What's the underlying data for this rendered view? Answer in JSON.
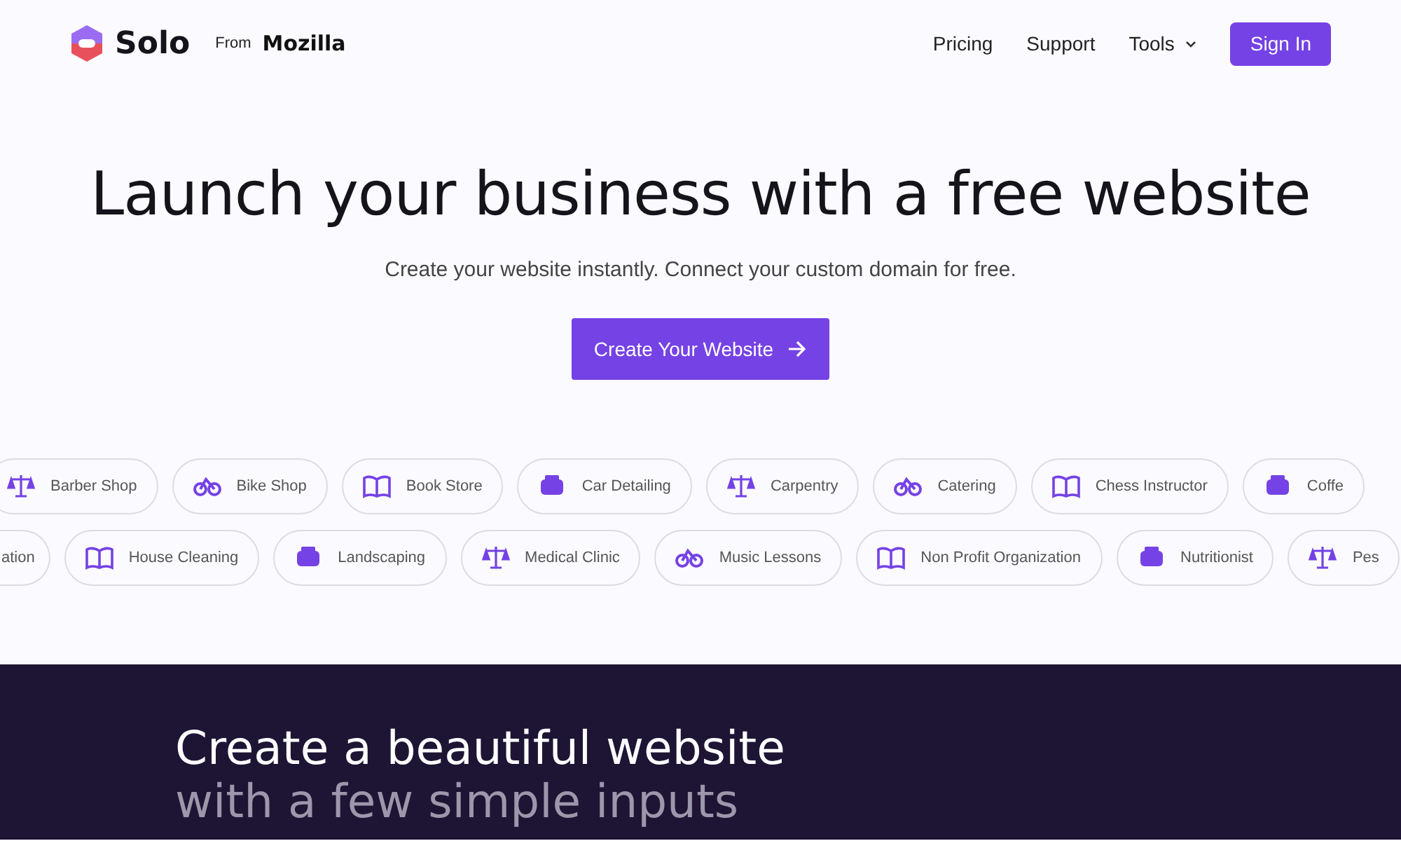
{
  "header": {
    "brand": "Solo",
    "from": "From",
    "partner": "Mozilla",
    "nav": [
      {
        "label": "Pricing",
        "kind": "link"
      },
      {
        "label": "Support",
        "kind": "link"
      },
      {
        "label": "Tools",
        "kind": "menu"
      }
    ],
    "sign_in": "Sign In"
  },
  "hero": {
    "title": "Launch your business with a free website",
    "subtitle": "Create your website instantly. Connect your custom domain for free.",
    "cta": "Create Your Website"
  },
  "chip_rows": [
    {
      "items": [
        "Barber Shop",
        "Bike Shop",
        "Book Store",
        "Car Detailing",
        "Carpentry",
        "Catering",
        "Chess Instructor",
        "Coffe"
      ]
    },
    {
      "items": [
        "ation",
        "House Cleaning",
        "Landscaping",
        "Medical Clinic",
        "Music Lessons",
        "Non Profit Organization",
        "Nutritionist",
        "Pes"
      ]
    }
  ],
  "feature": {
    "title": "Create a beautiful website",
    "subtitle": "with a few simple inputs"
  }
}
